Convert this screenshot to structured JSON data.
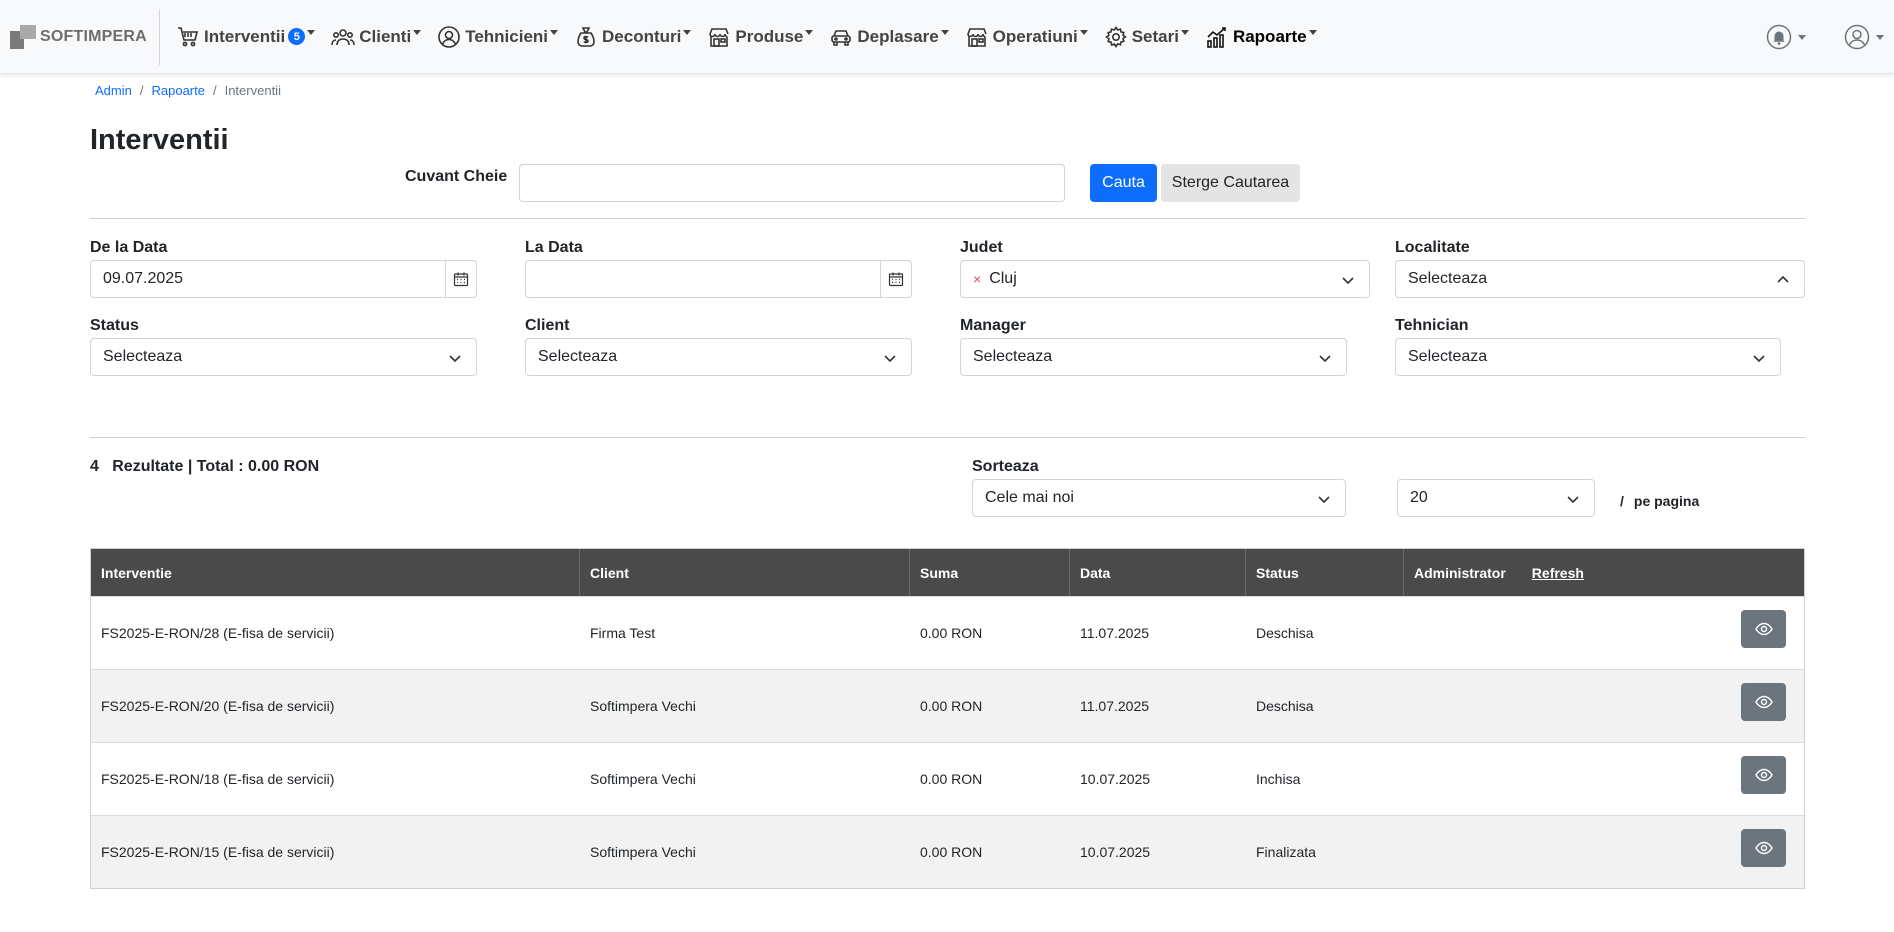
{
  "brand": {
    "name": "SOFTIMPERA"
  },
  "nav": {
    "items": [
      {
        "label": "Interventii",
        "icon": "cart-icon",
        "badge": "5"
      },
      {
        "label": "Clienti",
        "icon": "users-icon"
      },
      {
        "label": "Tehnicieni",
        "icon": "user-circle-icon"
      },
      {
        "label": "Deconturi",
        "icon": "money-bag-icon"
      },
      {
        "label": "Produse",
        "icon": "shop-icon"
      },
      {
        "label": "Deplasare",
        "icon": "car-icon"
      },
      {
        "label": "Operatiuni",
        "icon": "shop-icon"
      },
      {
        "label": "Setari",
        "icon": "gear-icon"
      },
      {
        "label": "Rapoarte",
        "icon": "chart-icon"
      }
    ],
    "right": [
      "bell-icon",
      "user-icon"
    ]
  },
  "breadcrumb": [
    "Admin",
    "Rapoarte",
    "Interventii"
  ],
  "page_title": "Interventii",
  "search": {
    "label": "Cuvant Cheie",
    "value": "",
    "search_button": "Cauta",
    "clear_button": "Sterge Cautarea"
  },
  "filters": {
    "from_date": {
      "label": "De la Data",
      "value": "09.07.2025"
    },
    "to_date": {
      "label": "La Data",
      "value": ""
    },
    "judet": {
      "label": "Judet",
      "value": "Cluj",
      "clear": "×"
    },
    "localitate": {
      "label": "Localitate",
      "value": "Selecteaza"
    },
    "status": {
      "label": "Status",
      "value": "Selecteaza"
    },
    "client": {
      "label": "Client",
      "value": "Selecteaza"
    },
    "manager": {
      "label": "Manager",
      "value": "Selecteaza"
    },
    "tehnician": {
      "label": "Tehnician",
      "value": "Selecteaza"
    }
  },
  "summary": {
    "count": "4",
    "text": "Rezultate | Total : 0.00 RON"
  },
  "sort": {
    "label": "Sorteaza",
    "value": "Cele mai noi"
  },
  "page_size": {
    "value": "20",
    "slash": "/",
    "label": "pe pagina"
  },
  "table": {
    "headers": [
      "Interventie",
      "Client",
      "Suma",
      "Data",
      "Status",
      "Administrator"
    ],
    "refresh_label": "Refresh",
    "rows": [
      [
        "FS2025-E-RON/28 (E-fisa de servicii)",
        "Firma Test",
        "0.00 RON",
        "11.07.2025",
        "Deschisa"
      ],
      [
        "FS2025-E-RON/20 (E-fisa de servicii)",
        "Softimpera Vechi",
        "0.00 RON",
        "11.07.2025",
        "Deschisa"
      ],
      [
        "FS2025-E-RON/18 (E-fisa de servicii)",
        "Softimpera Vechi",
        "0.00 RON",
        "10.07.2025",
        "Inchisa"
      ],
      [
        "FS2025-E-RON/15 (E-fisa de servicii)",
        "Softimpera Vechi",
        "0.00 RON",
        "10.07.2025",
        "Finalizata"
      ]
    ]
  },
  "colors": {
    "primary": "#0d6efd",
    "table_header": "#4a4a4a",
    "eye_button": "#6c757d"
  }
}
